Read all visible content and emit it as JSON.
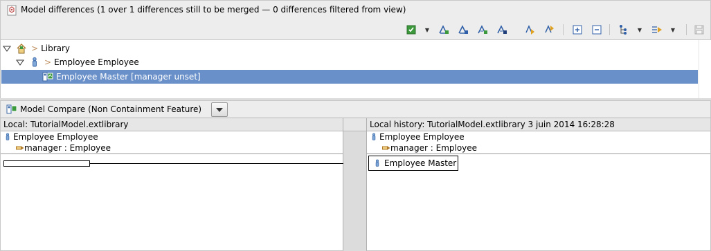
{
  "header": {
    "title": "Model differences  (1 over 1 differences still to be merged — 0 differences filtered from view)",
    "icon": "model-differences-icon"
  },
  "toolbar": {
    "buttons": [
      {
        "name": "select-all-button",
        "icon": "green-check-icon"
      },
      {
        "name": "accept-change-button",
        "icon": "accept-change-icon"
      },
      {
        "name": "reject-change-button",
        "icon": "reject-change-icon"
      },
      {
        "name": "accept-all-button",
        "icon": "accept-all-icon"
      },
      {
        "name": "reject-all-button",
        "icon": "reject-all-icon"
      },
      {
        "name": "next-difference-button",
        "icon": "next-diff-icon"
      },
      {
        "name": "previous-difference-button",
        "icon": "previous-diff-icon"
      },
      {
        "name": "expand-all-button",
        "icon": "expand-icon"
      },
      {
        "name": "collapse-all-button",
        "icon": "collapse-icon"
      },
      {
        "name": "group-button",
        "icon": "group-icon"
      },
      {
        "name": "filter-button",
        "icon": "filter-icon"
      },
      {
        "name": "save-button",
        "icon": "save-icon"
      }
    ]
  },
  "tree": {
    "nodes": [
      {
        "label": "Library",
        "prefix": ">",
        "icon": "library-icon",
        "expanded": true
      },
      {
        "label": "Employee Employee",
        "prefix": ">",
        "icon": "employee-icon",
        "expanded": true
      },
      {
        "label": "Employee Master [manager unset]",
        "icon": "diff-element-icon",
        "selected": true
      }
    ]
  },
  "compare": {
    "tab_label": "Model Compare (Non Containment Feature)",
    "left": {
      "title": "Local: TutorialModel.extlibrary",
      "item": "Employee Employee",
      "feature": "manager : Employee"
    },
    "right": {
      "title": "Local history: TutorialModel.extlibrary 3 juin 2014 16:28:28",
      "item": "Employee Employee",
      "feature": "manager : Employee",
      "value": "Employee Master"
    }
  },
  "colors": {
    "selection": "#6a90c9",
    "panel_bg": "#ededed",
    "accent_blue": "#2f5fa8",
    "accent_green": "#3c9a3c"
  }
}
